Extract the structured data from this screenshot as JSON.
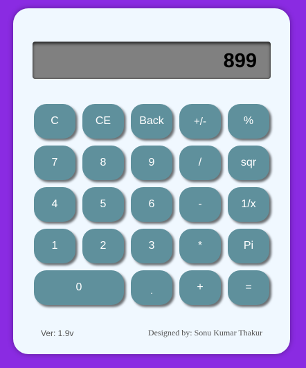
{
  "display": {
    "value": "899"
  },
  "buttons": {
    "clear": "C",
    "clear_entry": "CE",
    "back": "Back",
    "plus_minus": "+/-",
    "percent": "%",
    "seven": "7",
    "eight": "8",
    "nine": "9",
    "divide": "/",
    "sqr": "sqr",
    "four": "4",
    "five": "5",
    "six": "6",
    "minus": "-",
    "reciprocal": "1/x",
    "one": "1",
    "two": "2",
    "three": "3",
    "multiply": "*",
    "pi": "Pi",
    "zero": "0",
    "decimal": ".",
    "plus": "+",
    "equals": "="
  },
  "footer": {
    "version": "Ver: 1.9v",
    "credit": "Designed by: Sonu Kumar Thakur"
  },
  "colors": {
    "page_background": "#8a2be2",
    "panel": "#f0f8ff",
    "display": "#808080",
    "button": "#5f909c"
  }
}
